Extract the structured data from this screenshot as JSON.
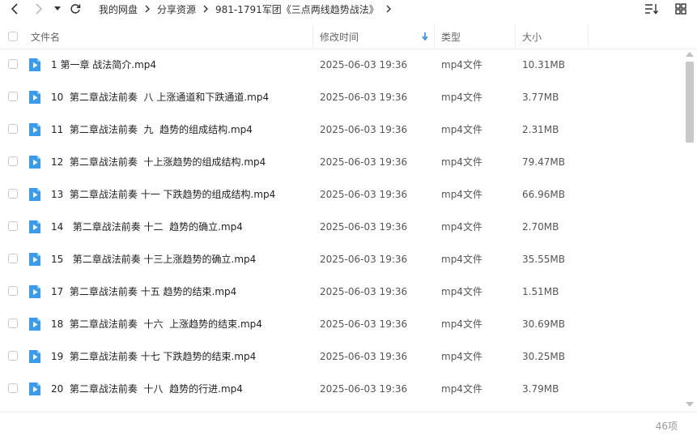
{
  "nav": {
    "back_label": "back",
    "forward_label": "forward",
    "dropdown_label": "history"
  },
  "breadcrumb": [
    {
      "label": "我的网盘"
    },
    {
      "label": "分享资源"
    },
    {
      "label": "981-1791军团《三点两线趋势战法》"
    }
  ],
  "columns": {
    "name": "文件名",
    "modified": "修改时间",
    "type": "类型",
    "size": "大小"
  },
  "files": [
    {
      "name": "1 第一章 战法简介.mp4",
      "modified": "2025-06-03 19:36",
      "type": "mp4文件",
      "size": "10.31MB"
    },
    {
      "name": "10  第二章战法前奏  八 上涨通道和下跌通道.mp4",
      "modified": "2025-06-03 19:36",
      "type": "mp4文件",
      "size": "3.77MB"
    },
    {
      "name": "11  第二章战法前奏  九  趋势的组成结构.mp4",
      "modified": "2025-06-03 19:36",
      "type": "mp4文件",
      "size": "2.31MB"
    },
    {
      "name": "12  第二章战法前奏  十上涨趋势的组成结构.mp4",
      "modified": "2025-06-03 19:36",
      "type": "mp4文件",
      "size": "79.47MB"
    },
    {
      "name": "13  第二章战法前奏 十一 下跌趋势的组成结构.mp4",
      "modified": "2025-06-03 19:36",
      "type": "mp4文件",
      "size": "66.96MB"
    },
    {
      "name": "14   第二章战法前奏 十二  趋势的确立.mp4",
      "modified": "2025-06-03 19:36",
      "type": "mp4文件",
      "size": "2.70MB"
    },
    {
      "name": "15   第二章战法前奏 十三上涨趋势的确立.mp4",
      "modified": "2025-06-03 19:36",
      "type": "mp4文件",
      "size": "35.55MB"
    },
    {
      "name": "17  第二章战法前奏 十五 趋势的结束.mp4",
      "modified": "2025-06-03 19:36",
      "type": "mp4文件",
      "size": "1.51MB"
    },
    {
      "name": "18  第二章战法前奏  十六  上涨趋势的结束.mp4",
      "modified": "2025-06-03 19:36",
      "type": "mp4文件",
      "size": "30.69MB"
    },
    {
      "name": "19  第二章战法前奏 十七 下跌趋势的结束.mp4",
      "modified": "2025-06-03 19:36",
      "type": "mp4文件",
      "size": "30.25MB"
    },
    {
      "name": "20  第二章战法前奏  十八  趋势的行进.mp4",
      "modified": "2025-06-03 19:36",
      "type": "mp4文件",
      "size": "3.79MB"
    }
  ],
  "footer": {
    "count": "46项"
  },
  "colors": {
    "accent": "#1e88e5",
    "video_icon": "#3a9bea"
  },
  "icons": {
    "back": "chevron-left-icon",
    "forward": "chevron-right-icon",
    "dropdown": "caret-down-icon",
    "refresh": "refresh-icon",
    "sort": "sort-list-icon",
    "grid": "grid-view-icon",
    "file": "video-file-icon"
  }
}
